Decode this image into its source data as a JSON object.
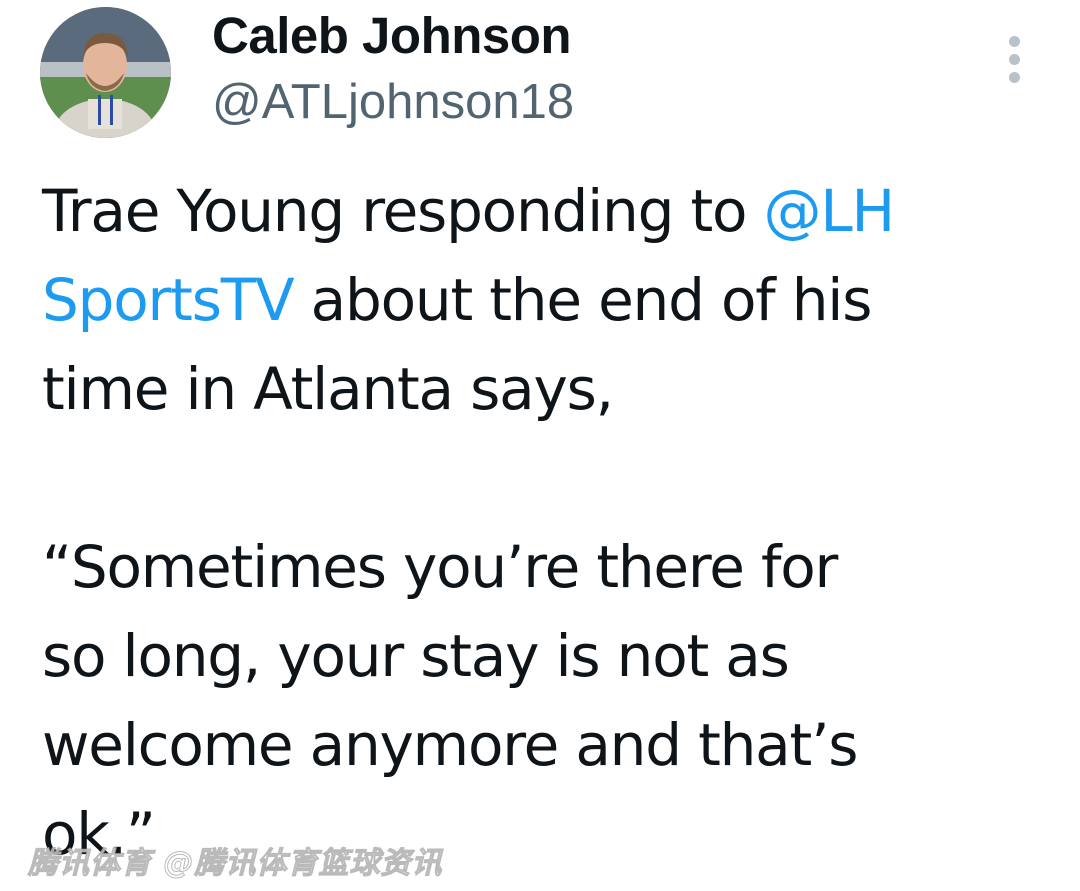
{
  "tweet": {
    "author": {
      "display_name": "Caleb Johnson",
      "handle": "@ATLjohnson18"
    },
    "more_icon": "more-vertical-icon",
    "text": {
      "line1_prefix": "Trae Young responding to ",
      "line1_mention": "@LH",
      "line2_mention": "SportsTV",
      "line2_suffix": " about the end of his",
      "line3": "time in Atlanta says,",
      "quote_line1": "“Sometimes you’re there for",
      "quote_line2": "so long, your stay is not as",
      "quote_line3": "welcome anymore and that’s",
      "quote_line4": "ok.”"
    },
    "colors": {
      "mention": "#1d9bf0",
      "text": "#0f1419",
      "secondary": "#536471"
    }
  },
  "watermark": "腾讯体育 @腾讯体育篮球资讯"
}
